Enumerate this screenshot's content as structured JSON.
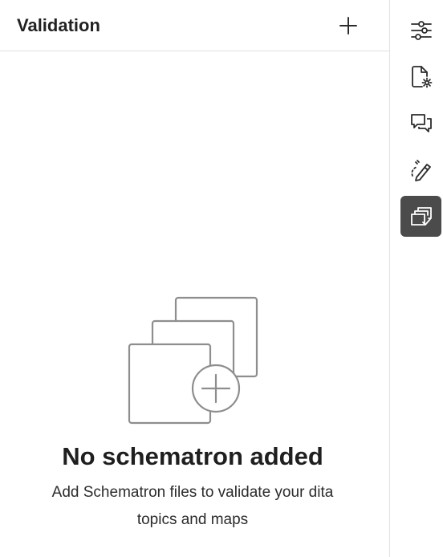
{
  "panel": {
    "title": "Validation",
    "add_icon": "plus-icon"
  },
  "empty_state": {
    "illustration_icon": "stacked-files-add-icon",
    "title": "No schematron added",
    "description": "Add Schematron files to validate your dita topics and maps"
  },
  "rail": {
    "items": [
      {
        "icon": "sliders-icon",
        "active": false
      },
      {
        "icon": "file-settings-icon",
        "active": false
      },
      {
        "icon": "comments-icon",
        "active": false
      },
      {
        "icon": "pen-path-icon",
        "active": false
      },
      {
        "icon": "validation-check-icon",
        "active": true
      }
    ]
  },
  "colors": {
    "active_bg": "#4b4b4b",
    "icon": "#2c2c2c",
    "divider": "#e1e1e1",
    "illustration": "#8e8e8e"
  }
}
